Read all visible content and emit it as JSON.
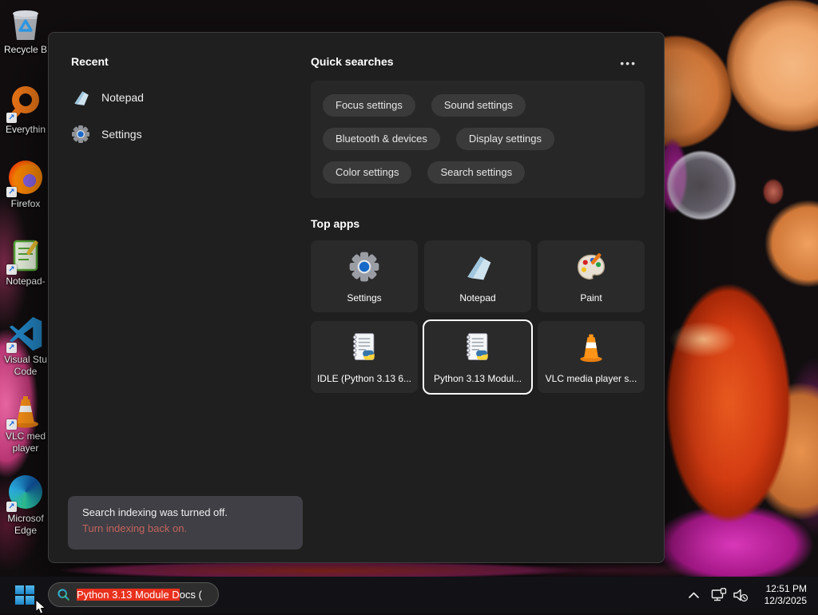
{
  "desktop": {
    "icons": [
      {
        "name": "recycle-bin",
        "line1": "Recycle B",
        "line2": ""
      },
      {
        "name": "everything",
        "line1": "Everythin",
        "line2": ""
      },
      {
        "name": "firefox",
        "line1": "Firefox",
        "line2": ""
      },
      {
        "name": "notepad-plus-plus",
        "line1": "Notepad-",
        "line2": ""
      },
      {
        "name": "visual-studio-code",
        "line1": "Visual Stu",
        "line2": "Code"
      },
      {
        "name": "vlc-media-player",
        "line1": "VLC med",
        "line2": "player"
      },
      {
        "name": "microsoft-edge",
        "line1": "Microsof",
        "line2": "Edge"
      }
    ]
  },
  "panel": {
    "recent": {
      "title": "Recent",
      "items": [
        {
          "label": "Notepad"
        },
        {
          "label": "Settings"
        }
      ]
    },
    "quick": {
      "title": "Quick searches",
      "more": "•••",
      "pills": [
        "Focus settings",
        "Sound settings",
        "Bluetooth & devices",
        "Display settings",
        "Color settings",
        "Search settings"
      ]
    },
    "top_apps": {
      "title": "Top apps",
      "tiles": [
        {
          "label": "Settings"
        },
        {
          "label": "Notepad"
        },
        {
          "label": "Paint"
        },
        {
          "label": "IDLE (Python 3.13 6..."
        },
        {
          "label": "Python 3.13 Modul...",
          "selected": true
        },
        {
          "label": "VLC media player s..."
        }
      ]
    },
    "notice": {
      "message": "Search indexing was turned off.",
      "action": "Turn indexing back on."
    }
  },
  "taskbar": {
    "search": {
      "highlight": "Python 3.13 Module D",
      "rest": "ocs ("
    },
    "clock": {
      "time": "12:51 PM",
      "date": "12/3/2025"
    }
  },
  "colors": {
    "selection_red": "#e8301c",
    "link_red": "#c4635c",
    "panel_bg": "#1f1f1f",
    "taskbar_bg": "#121216"
  }
}
